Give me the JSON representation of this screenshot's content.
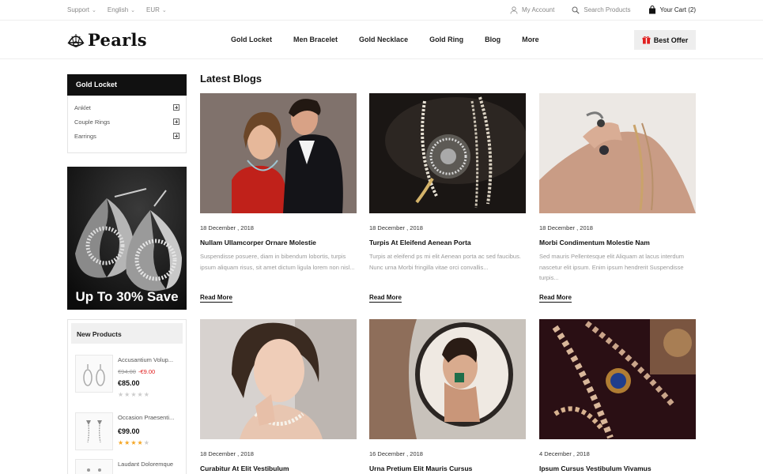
{
  "topbar": {
    "support": "Support",
    "language": "English",
    "currency": "EUR",
    "account": "My Account",
    "search": "Search Products",
    "cart": "Your Cart (2)"
  },
  "header": {
    "logo": "Pearls",
    "nav": [
      "Gold Locket",
      "Men Bracelet",
      "Gold Necklace",
      "Gold Ring",
      "Blog",
      "More"
    ],
    "best_offer": "Best Offer"
  },
  "sidebar": {
    "category_title": "Gold Locket",
    "categories": [
      "Anklet",
      "Couple Rings",
      "Earrings"
    ],
    "banner_caption": "Up To 30% Save",
    "new_products_title": "New Products",
    "products": [
      {
        "name": "Accusantium Volup...",
        "old_price": "€94.00",
        "discount": "-€9.00",
        "price": "€85.00",
        "rating": 0
      },
      {
        "name": "Occasion Praesenti...",
        "old_price": "",
        "discount": "",
        "price": "€99.00",
        "rating": 4
      },
      {
        "name": "Laudant Doloremque",
        "old_price": "",
        "discount": "",
        "price": "",
        "rating": 0
      }
    ]
  },
  "main": {
    "title": "Latest Blogs",
    "read_more": "Read More",
    "posts": [
      {
        "date": "18 December , 2018",
        "title": "Nullam Ullamcorper Ornare Molestie",
        "desc": "Suspendisse posuere, diam in bibendum lobortis, turpis ipsum aliquam risus, sit amet dictum ligula lorem non nisl..."
      },
      {
        "date": "18 December , 2018",
        "title": "Turpis At Eleifend Aenean Porta",
        "desc": "Turpis at eleifend ps mi elit Aenean porta ac sed faucibus. Nunc urna Morbi fringilla vitae orci convallis..."
      },
      {
        "date": "18 December , 2018",
        "title": "Morbi Condimentum Molestie Nam",
        "desc": "Sed mauris Pellentesque elit Aliquam at lacus interdum nascetur elit ipsum. Enim ipsum hendrerit Suspendisse turpis..."
      },
      {
        "date": "18 December , 2018",
        "title": "Curabitur At Elit Vestibulum",
        "desc": ""
      },
      {
        "date": "16 December , 2018",
        "title": "Urna Pretium Elit Mauris Cursus",
        "desc": ""
      },
      {
        "date": "4 December , 2018",
        "title": "Ipsum Cursus Vestibulum Vivamus",
        "desc": ""
      }
    ]
  },
  "colors": {
    "primary": "#111111",
    "accent_red": "#e02020",
    "star": "#f5a623",
    "muted": "#999999"
  }
}
